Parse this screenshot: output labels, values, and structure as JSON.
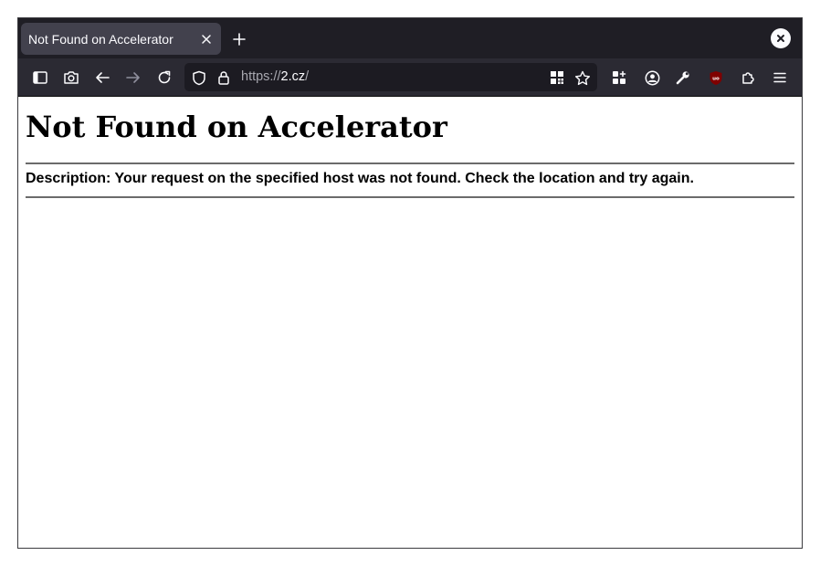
{
  "browser": {
    "tab_title": "Not Found on Accelerator",
    "url_scheme": "https://",
    "url_host": "2.cz",
    "url_path": "/",
    "colors": {
      "tabbar_bg": "#1f1e25",
      "tab_bg": "#42414d",
      "toolbar_bg": "#2b2a33",
      "urlbar_bg": "#1c1b22",
      "ublock_red": "#800000"
    },
    "icons": [
      "sidebar-icon",
      "screenshot-icon",
      "back-arrow-icon",
      "forward-arrow-icon",
      "reload-icon",
      "shield-icon",
      "lock-icon",
      "qr-code-icon",
      "star-icon",
      "extensions-grid-icon",
      "account-icon",
      "wrench-icon",
      "ublock-icon",
      "puzzle-icon",
      "hamburger-menu-icon"
    ]
  },
  "page": {
    "heading": "Not Found on Accelerator",
    "description": "Description: Your request on the specified host was not found. Check the location and try again."
  }
}
